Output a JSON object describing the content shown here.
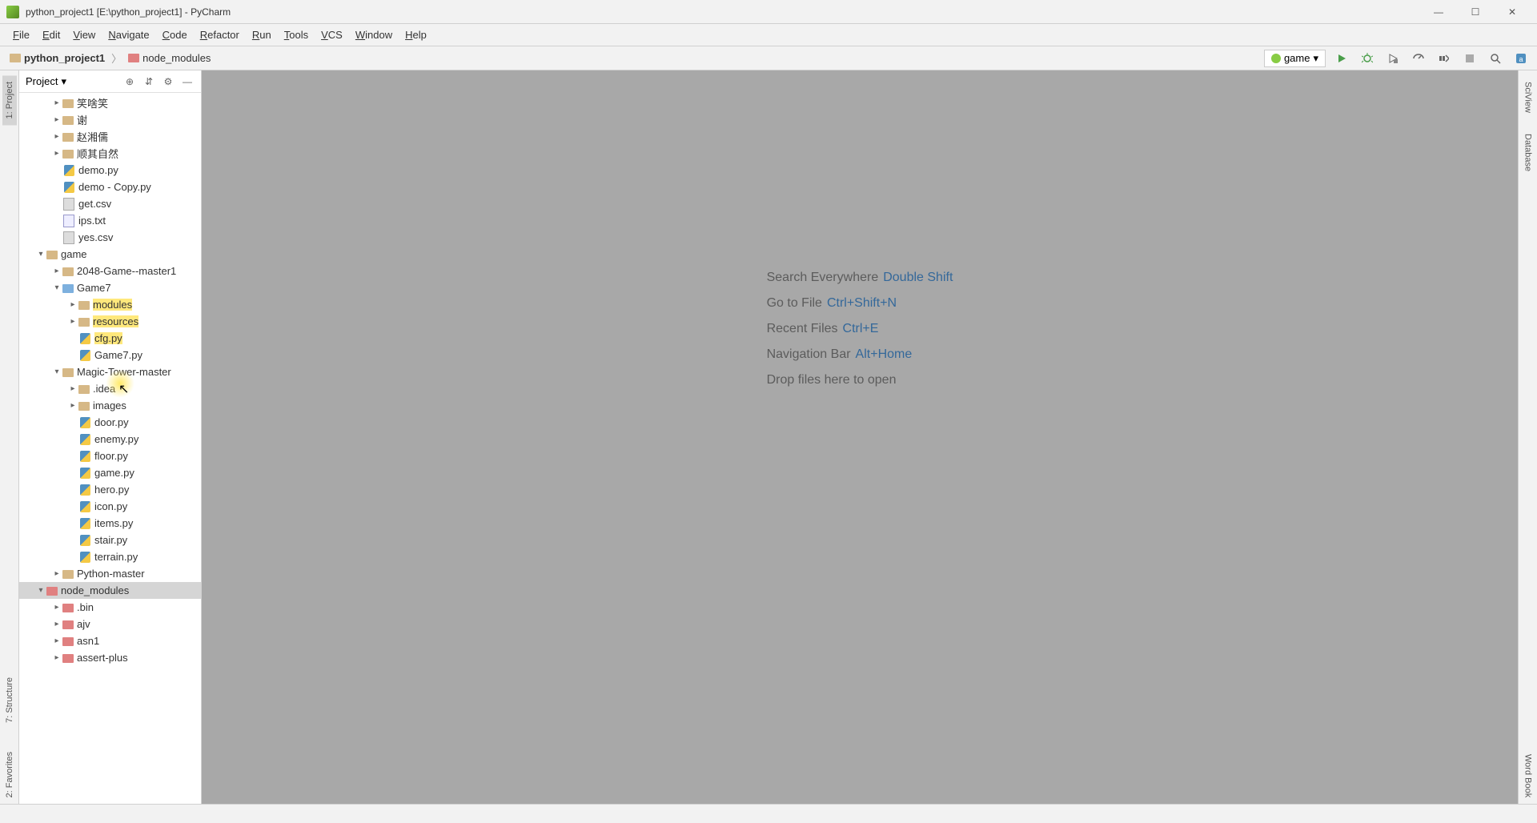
{
  "window": {
    "title": "python_project1 [E:\\python_project1] - PyCharm"
  },
  "menu": [
    "File",
    "Edit",
    "View",
    "Navigate",
    "Code",
    "Refactor",
    "Run",
    "Tools",
    "VCS",
    "Window",
    "Help"
  ],
  "breadcrumbs": [
    {
      "label": "python_project1",
      "bold": true,
      "excluded": false
    },
    {
      "label": "node_modules",
      "bold": false,
      "excluded": true
    }
  ],
  "run_config": {
    "label": "game"
  },
  "project_panel": {
    "title": "Project"
  },
  "left_tabs": [
    "1: Project",
    "7: Structure",
    "2: Favorites"
  ],
  "right_tabs": [
    "SciView",
    "Database",
    "Word Book"
  ],
  "tree": [
    {
      "indent": 2,
      "exp": ">",
      "icon": "folder",
      "label": "笑啥笑"
    },
    {
      "indent": 2,
      "exp": ">",
      "icon": "folder",
      "label": "谢"
    },
    {
      "indent": 2,
      "exp": ">",
      "icon": "folder",
      "label": "赵湘儒"
    },
    {
      "indent": 2,
      "exp": ">",
      "icon": "folder",
      "label": "顺其自然"
    },
    {
      "indent": 2,
      "exp": "",
      "icon": "pyfile",
      "label": "demo.py"
    },
    {
      "indent": 2,
      "exp": "",
      "icon": "pyfile",
      "label": "demo - Copy.py"
    },
    {
      "indent": 2,
      "exp": "",
      "icon": "csvfile",
      "label": "get.csv"
    },
    {
      "indent": 2,
      "exp": "",
      "icon": "txtfile",
      "label": "ips.txt"
    },
    {
      "indent": 2,
      "exp": "",
      "icon": "csvfile",
      "label": "yes.csv"
    },
    {
      "indent": 1,
      "exp": "v",
      "icon": "folder",
      "label": "game"
    },
    {
      "indent": 2,
      "exp": ">",
      "icon": "folder",
      "label": "2048-Game--master1"
    },
    {
      "indent": 2,
      "exp": "v",
      "icon": "folder src",
      "label": "Game7"
    },
    {
      "indent": 3,
      "exp": ">",
      "icon": "folder",
      "label": "modules",
      "hl": true
    },
    {
      "indent": 3,
      "exp": ">",
      "icon": "folder",
      "label": "resources",
      "hl": true
    },
    {
      "indent": 3,
      "exp": "",
      "icon": "pyfile",
      "label": "cfg.py",
      "hl": true
    },
    {
      "indent": 3,
      "exp": "",
      "icon": "pyfile",
      "label": "Game7.py"
    },
    {
      "indent": 2,
      "exp": "v",
      "icon": "folder",
      "label": "Magic-Tower-master"
    },
    {
      "indent": 3,
      "exp": ">",
      "icon": "folder",
      "label": ".idea"
    },
    {
      "indent": 3,
      "exp": ">",
      "icon": "folder",
      "label": "images"
    },
    {
      "indent": 3,
      "exp": "",
      "icon": "pyfile",
      "label": "door.py"
    },
    {
      "indent": 3,
      "exp": "",
      "icon": "pyfile",
      "label": "enemy.py"
    },
    {
      "indent": 3,
      "exp": "",
      "icon": "pyfile",
      "label": "floor.py"
    },
    {
      "indent": 3,
      "exp": "",
      "icon": "pyfile",
      "label": "game.py"
    },
    {
      "indent": 3,
      "exp": "",
      "icon": "pyfile",
      "label": "hero.py"
    },
    {
      "indent": 3,
      "exp": "",
      "icon": "pyfile",
      "label": "icon.py"
    },
    {
      "indent": 3,
      "exp": "",
      "icon": "pyfile",
      "label": "items.py"
    },
    {
      "indent": 3,
      "exp": "",
      "icon": "pyfile",
      "label": "stair.py"
    },
    {
      "indent": 3,
      "exp": "",
      "icon": "pyfile",
      "label": "terrain.py"
    },
    {
      "indent": 2,
      "exp": ">",
      "icon": "folder",
      "label": "Python-master"
    },
    {
      "indent": 1,
      "exp": "v",
      "icon": "folder excl",
      "label": "node_modules",
      "sel": true
    },
    {
      "indent": 2,
      "exp": ">",
      "icon": "folder excl",
      "label": ".bin"
    },
    {
      "indent": 2,
      "exp": ">",
      "icon": "folder excl",
      "label": "ajv"
    },
    {
      "indent": 2,
      "exp": ">",
      "icon": "folder excl",
      "label": "asn1"
    },
    {
      "indent": 2,
      "exp": ">",
      "icon": "folder excl",
      "label": "assert-plus"
    }
  ],
  "welcome": [
    {
      "text": "Search Everywhere",
      "key": "Double Shift"
    },
    {
      "text": "Go to File",
      "key": "Ctrl+Shift+N"
    },
    {
      "text": "Recent Files",
      "key": "Ctrl+E"
    },
    {
      "text": "Navigation Bar",
      "key": "Alt+Home"
    },
    {
      "text": "Drop files here to open",
      "key": ""
    }
  ]
}
